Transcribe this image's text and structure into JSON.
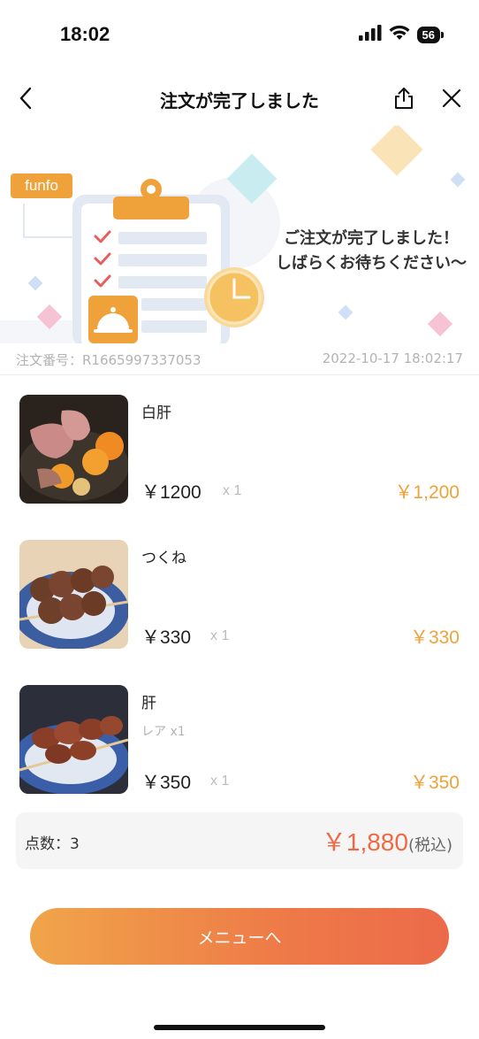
{
  "status_bar": {
    "time": "18:02",
    "battery": "56"
  },
  "nav": {
    "title": "注文が完了しました"
  },
  "banner": {
    "brand": "funfo",
    "message_line1": "ご注文が完了しました！",
    "message_line2": "しばらくお待ちください〜"
  },
  "order": {
    "number": "注文番号：R1665997337053",
    "datetime": "2022-10-17 18:02:17"
  },
  "items": [
    {
      "name": "白肝",
      "option": "",
      "price": "￥1200",
      "qty": "x 1",
      "subtotal": "￥1,200"
    },
    {
      "name": "つくね",
      "option": "",
      "price": "￥330",
      "qty": "x 1",
      "subtotal": "￥330"
    },
    {
      "name": "肝",
      "option": "レア x1",
      "price": "￥350",
      "qty": "x 1",
      "subtotal": "￥350"
    }
  ],
  "summary": {
    "count": "点数：3",
    "total": "￥1,880",
    "tax_note": "(税込)"
  },
  "menu_button": {
    "label": "メニューへ"
  },
  "colors": {
    "accent": "#f0a23a",
    "total": "#ef6a44"
  }
}
